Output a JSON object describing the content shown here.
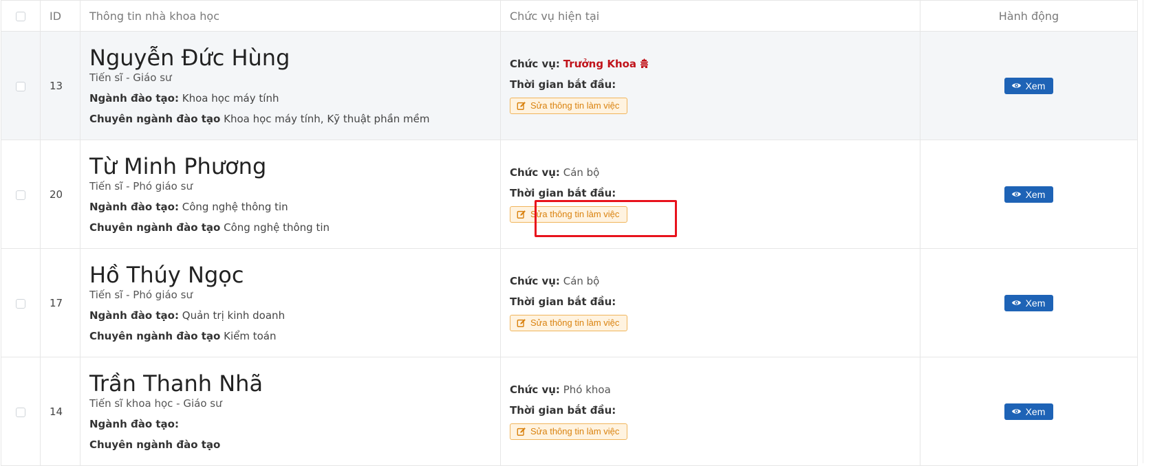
{
  "table": {
    "headers": {
      "id": "ID",
      "info": "Thông tin nhà khoa học",
      "position": "Chức vụ hiện tại",
      "action": "Hành động"
    },
    "labels": {
      "major": "Ngành đào tạo:",
      "specialty": "Chuyên ngành đào tạo",
      "position": "Chức vụ:",
      "start": "Thời gian bắt đầu:",
      "edit": "Sửa thông tin làm việc",
      "view": "Xem"
    },
    "rows": [
      {
        "id": "13",
        "name": "Nguyễn Đức Hùng",
        "degree": "Tiến sĩ - Giáo sư",
        "major": "Khoa học máy tính",
        "specialty": "Khoa học máy tính, Kỹ thuật phần mềm",
        "position": "Trưởng Khoa",
        "position_highlight": true
      },
      {
        "id": "20",
        "name": "Từ Minh Phương",
        "degree": "Tiến sĩ - Phó giáo sư",
        "major": "Công nghệ thông tin",
        "specialty": "Công nghệ thông tin",
        "position": "Cán bộ",
        "position_highlight": false
      },
      {
        "id": "17",
        "name": "Hồ Thúy Ngọc",
        "degree": "Tiến sĩ - Phó giáo sư",
        "major": "Quản trị kinh doanh",
        "specialty": "Kiểm toán",
        "position": "Cán bộ",
        "position_highlight": false
      },
      {
        "id": "14",
        "name": "Trần Thanh Nhã",
        "degree": "Tiến sĩ khoa học - Giáo sư",
        "major": "",
        "specialty": "",
        "position": "Phó khoa",
        "position_highlight": false
      }
    ]
  },
  "colors": {
    "accent_red": "#c0141b",
    "view_button": "#1e63b6",
    "edit_button_text": "#d9820f",
    "highlight_box": "#e8121c"
  }
}
